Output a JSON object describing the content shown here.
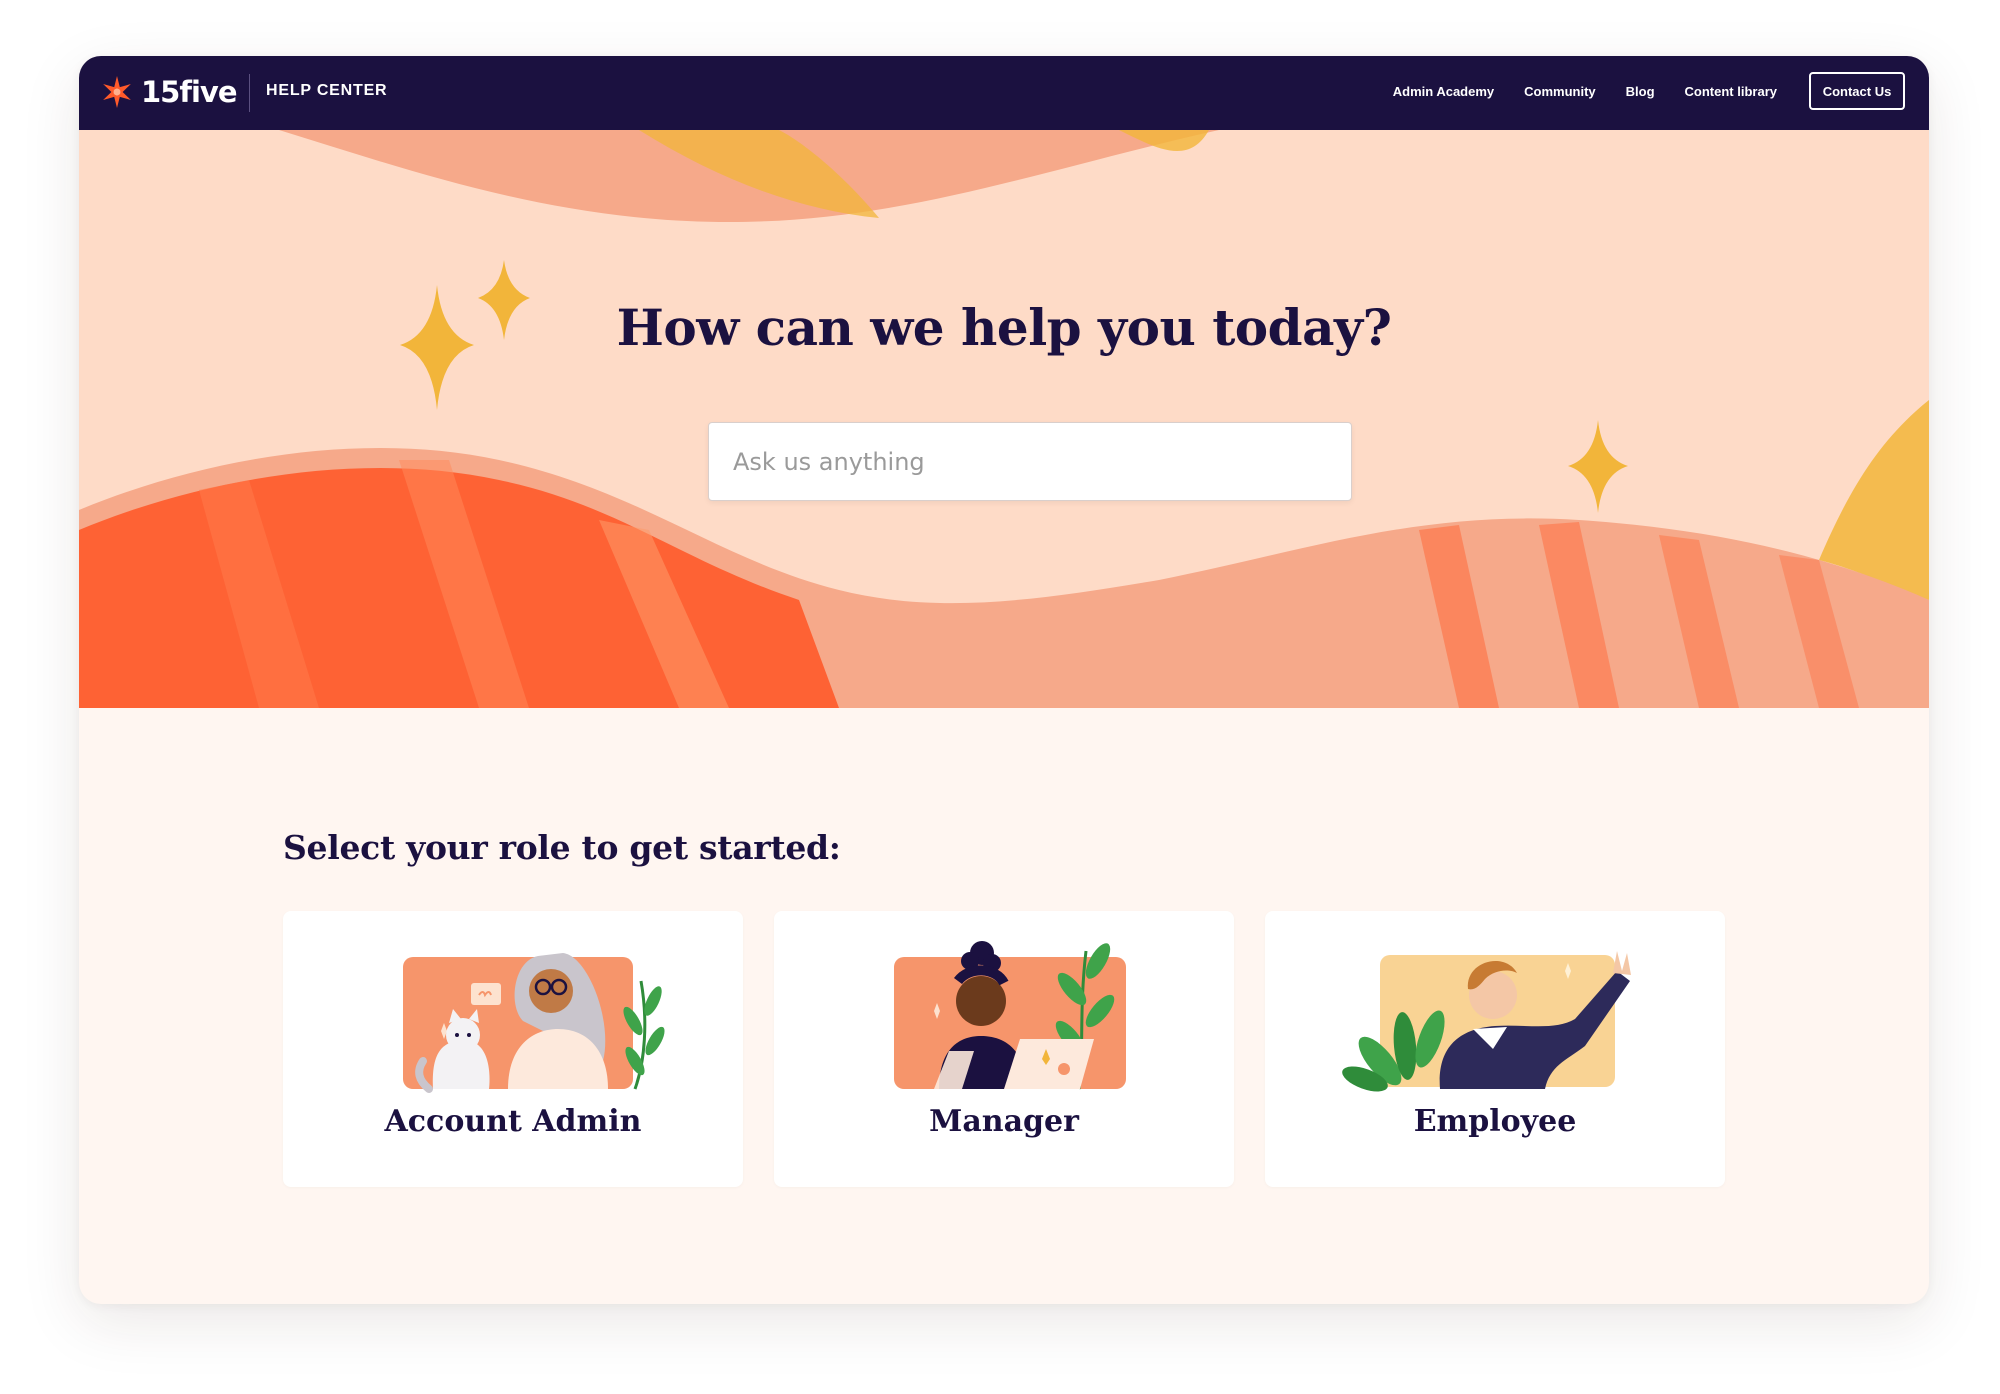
{
  "nav": {
    "logo_text": "15five",
    "section": "HELP CENTER",
    "links": [
      {
        "label": "Admin Academy"
      },
      {
        "label": "Community"
      },
      {
        "label": "Blog"
      },
      {
        "label": "Content library"
      }
    ],
    "contact_label": "Contact Us"
  },
  "hero": {
    "title": "How can we help you today?",
    "search": {
      "placeholder": "Ask us anything",
      "value": ""
    }
  },
  "roles": {
    "title": "Select your role to get started:",
    "cards": [
      {
        "label": "Account Admin",
        "illustration": "admin-with-cat-illustration"
      },
      {
        "label": "Manager",
        "illustration": "manager-with-laptop-illustration"
      },
      {
        "label": "Employee",
        "illustration": "employee-waving-illustration"
      }
    ]
  },
  "colors": {
    "navy": "#1b1140",
    "hero_bg": "#fedbc7",
    "orange": "#ff5a2a",
    "gold": "#f2b53a",
    "page_bg": "#fff6f1"
  }
}
